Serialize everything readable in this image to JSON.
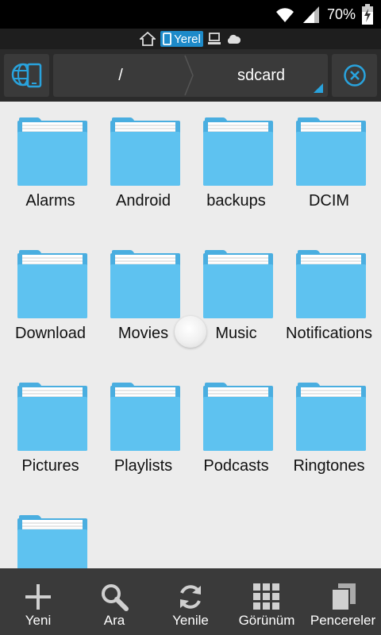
{
  "status": {
    "battery_text": "70%"
  },
  "locations": [
    {
      "label": "Yerel",
      "icon": "phone-icon",
      "active": true
    },
    {
      "label": "",
      "icon": "computer-icon",
      "active": false
    },
    {
      "label": "",
      "icon": "cloud-icon",
      "active": false
    }
  ],
  "breadcrumb": {
    "root": "/",
    "current": "sdcard"
  },
  "folders": [
    "Alarms",
    "Android",
    "backups",
    "DCIM",
    "Download",
    "Movies",
    "Music",
    "Notifications",
    "Pictures",
    "Playlists",
    "Podcasts",
    "Ringtones",
    ""
  ],
  "toolbar": {
    "new_label": "Yeni",
    "search_label": "Ara",
    "refresh_label": "Yenile",
    "view_label": "Görünüm",
    "windows_label": "Pencereler"
  },
  "colors": {
    "folder": "#5ec2f0",
    "folder_tab": "#4aaee0",
    "accent": "#1d8ac9",
    "toolbar": "#3a3a3a"
  }
}
